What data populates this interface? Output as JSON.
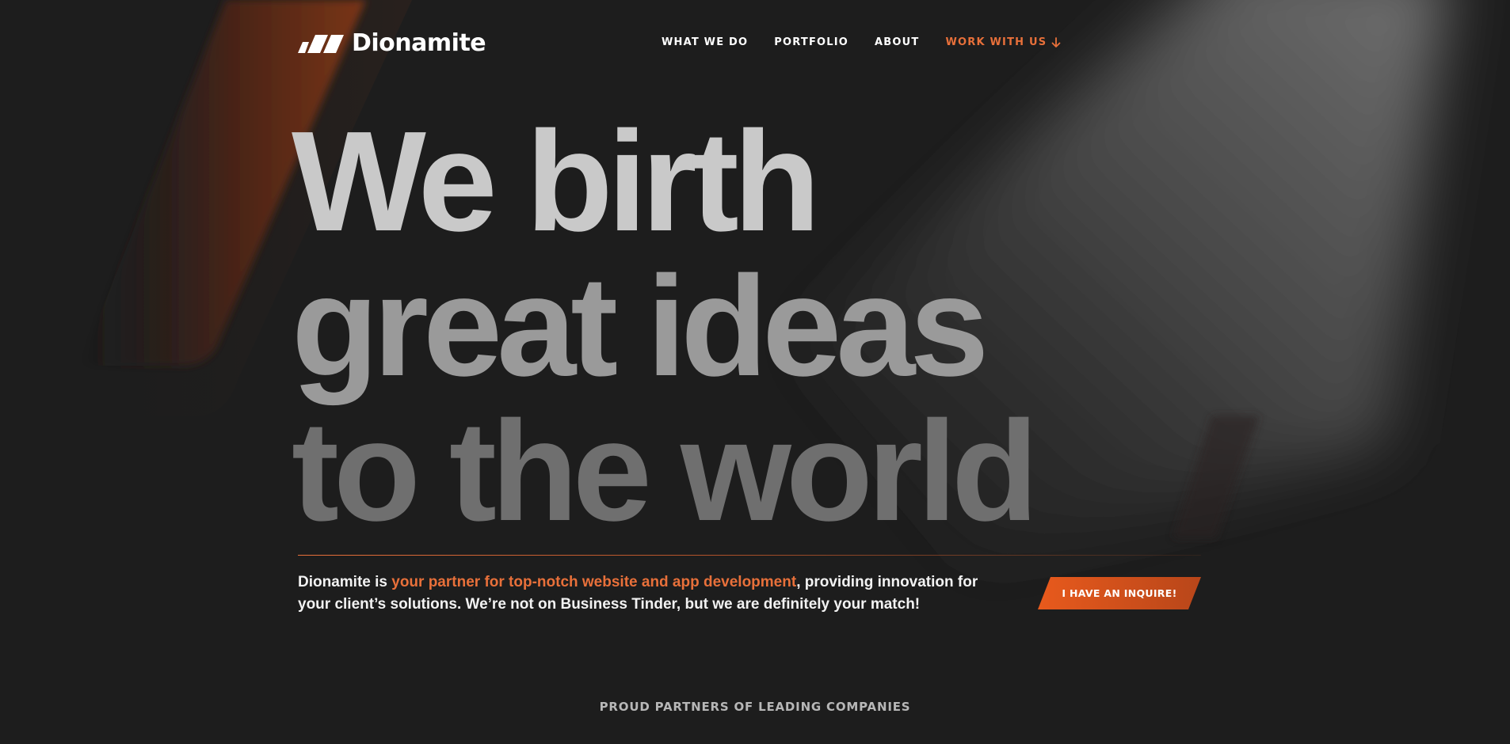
{
  "brand": {
    "name": "Dionamite",
    "accent_color": "#e8703a",
    "background_color": "#1d1d1d"
  },
  "nav": {
    "items": [
      {
        "label": "WHAT WE DO"
      },
      {
        "label": "PORTFOLIO"
      },
      {
        "label": "ABOUT"
      },
      {
        "label": "WORK WITH US",
        "icon": "arrow-down-icon"
      }
    ]
  },
  "hero": {
    "line1": "We birth",
    "line2": "great ideas",
    "line3": "to the world",
    "lead_prefix": "Dionamite is ",
    "lead_highlight": "your partner for top-notch website and app development",
    "lead_suffix": ", providing innovation for your client’s solutions. We’re not on Business Tinder, but we are definitely your match!",
    "cta_label": "I HAVE AN INQUIRE!"
  },
  "partners": {
    "heading": "PROUD PARTNERS OF LEADING COMPANIES"
  }
}
